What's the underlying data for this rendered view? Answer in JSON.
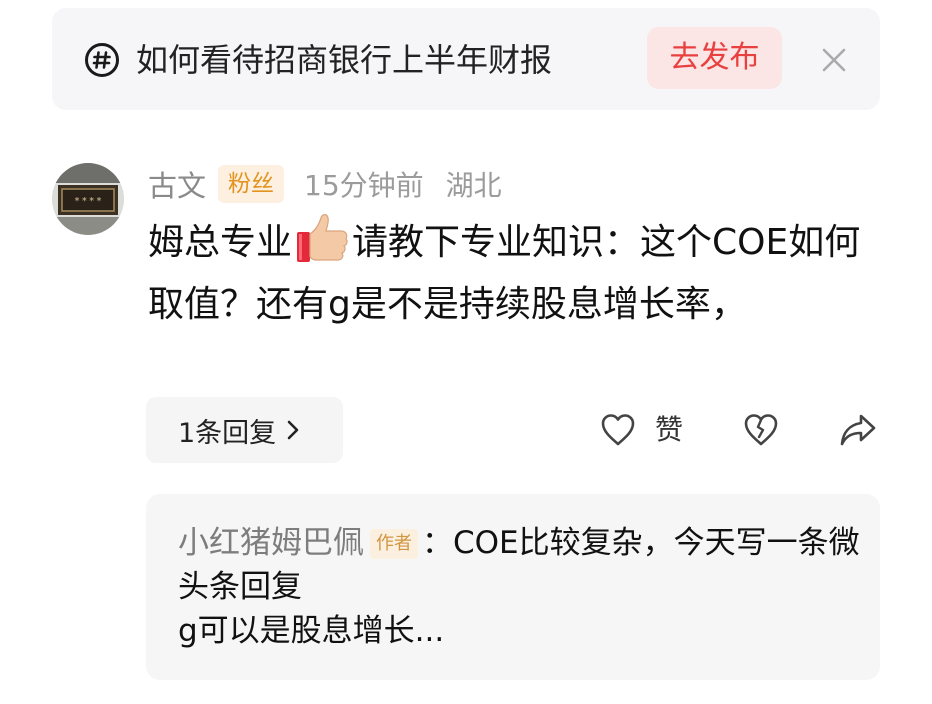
{
  "topic": {
    "icon": "hashtag-circle-icon",
    "title": "如何看待招商银行上半年财报",
    "publish_label": "去发布",
    "close_icon": "close-icon",
    "accent_color": "#e8403f"
  },
  "comment": {
    "avatar": "avatar-icon",
    "user_name": "古文",
    "fan_badge": "粉丝",
    "time": "15分钟前",
    "location": "湖北",
    "text_before_emoji": "姆总专业",
    "emoji": "thumbs-up-icon",
    "text_after_emoji": "请教下专业知识：这个COE如何取值？还有g是不是持续股息增长率，"
  },
  "actions": {
    "reply_count_label": "1条回复",
    "like_icon": "heart-outline-icon",
    "like_label": "赞",
    "dislike_icon": "broken-heart-icon",
    "share_icon": "share-arrow-icon"
  },
  "reply": {
    "author": "小红猪姆巴佩",
    "author_tag": "作者",
    "line_1": "：COE比较复杂，今天写一条微头条回复",
    "line_2": "g可以是股息增长..."
  }
}
